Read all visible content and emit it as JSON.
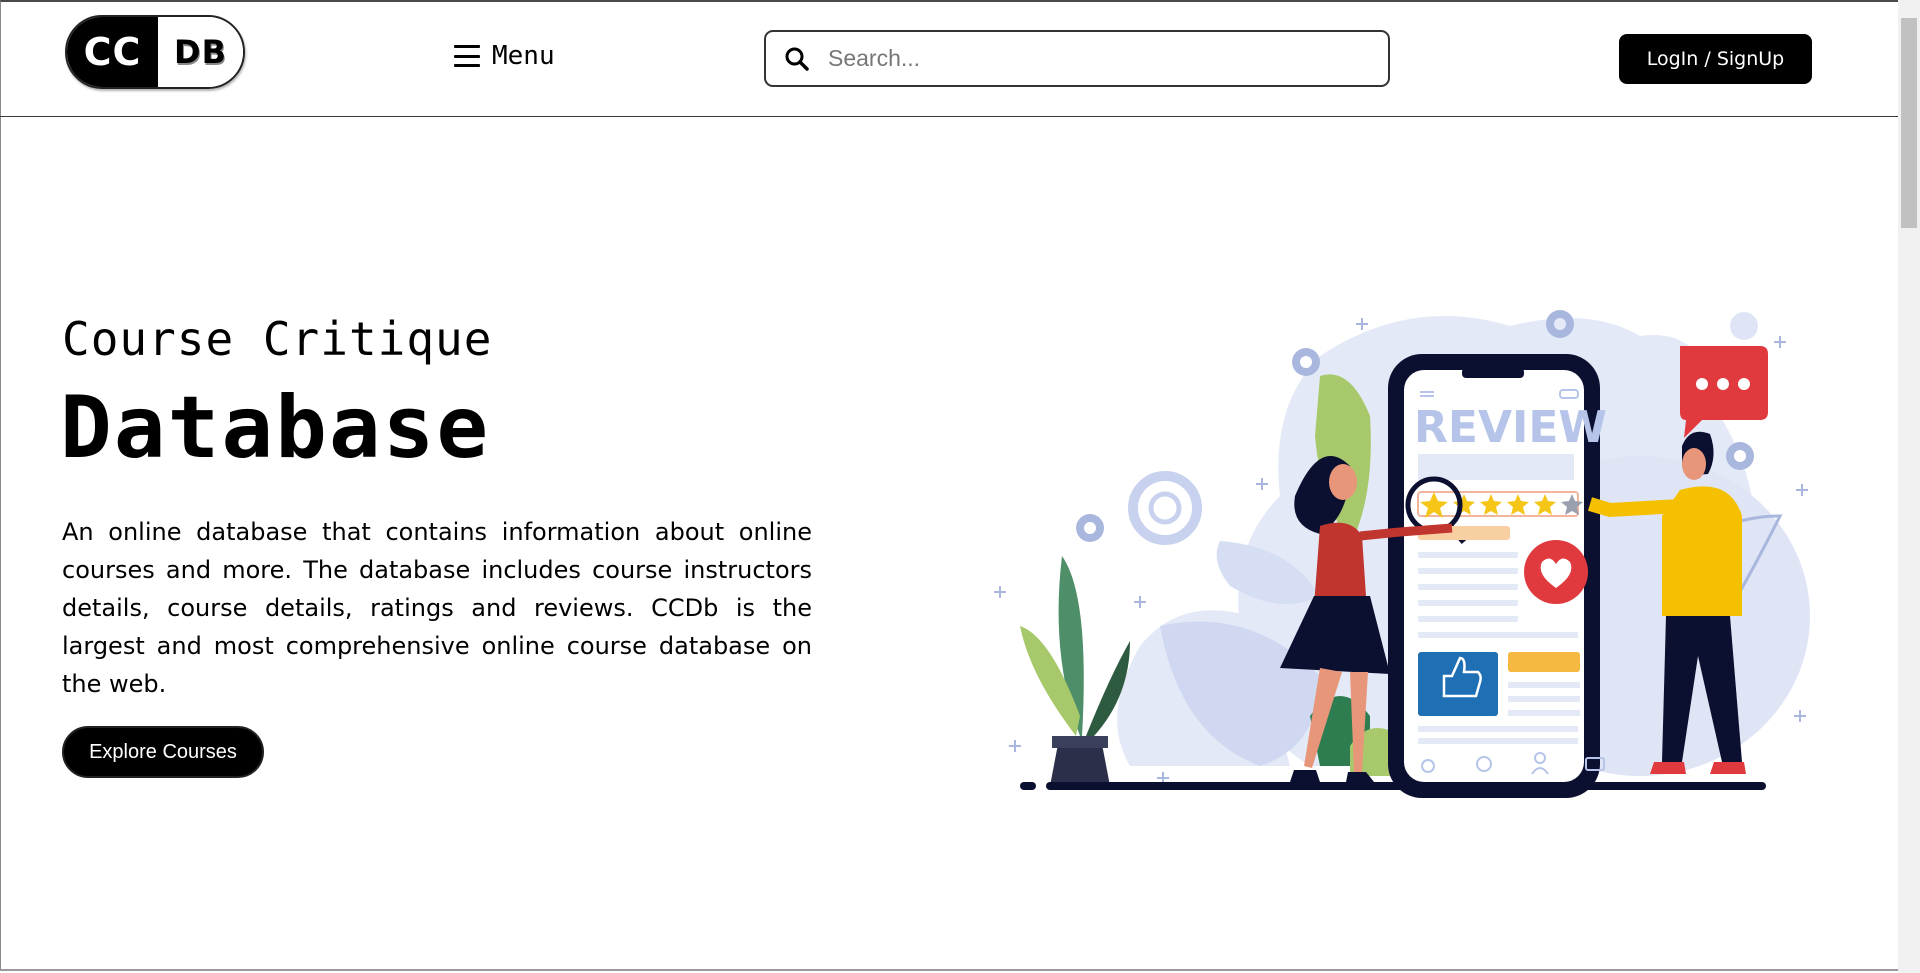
{
  "header": {
    "logo_left": "CC",
    "logo_right": "DB",
    "menu_label": "Menu",
    "search_placeholder": "Search...",
    "login_label": "LogIn / SignUp"
  },
  "hero": {
    "subtitle": "Course Critique",
    "title": "Database",
    "description": "An online database that contains information about online courses and more. The database includes course instructors details, course details, ratings and reviews. CCDb is the largest and most comprehensive online course database on the web.",
    "explore_label": "Explore Courses"
  },
  "illustration": {
    "review_text": "REVIEW",
    "rating_stars": 4,
    "rating_max": 5
  },
  "colors": {
    "primary": "#000000",
    "illustration_blue": "#b5c4e8",
    "star_yellow": "#f5c518",
    "heart_red": "#e03a3e",
    "shirt_yellow": "#f5c000"
  }
}
